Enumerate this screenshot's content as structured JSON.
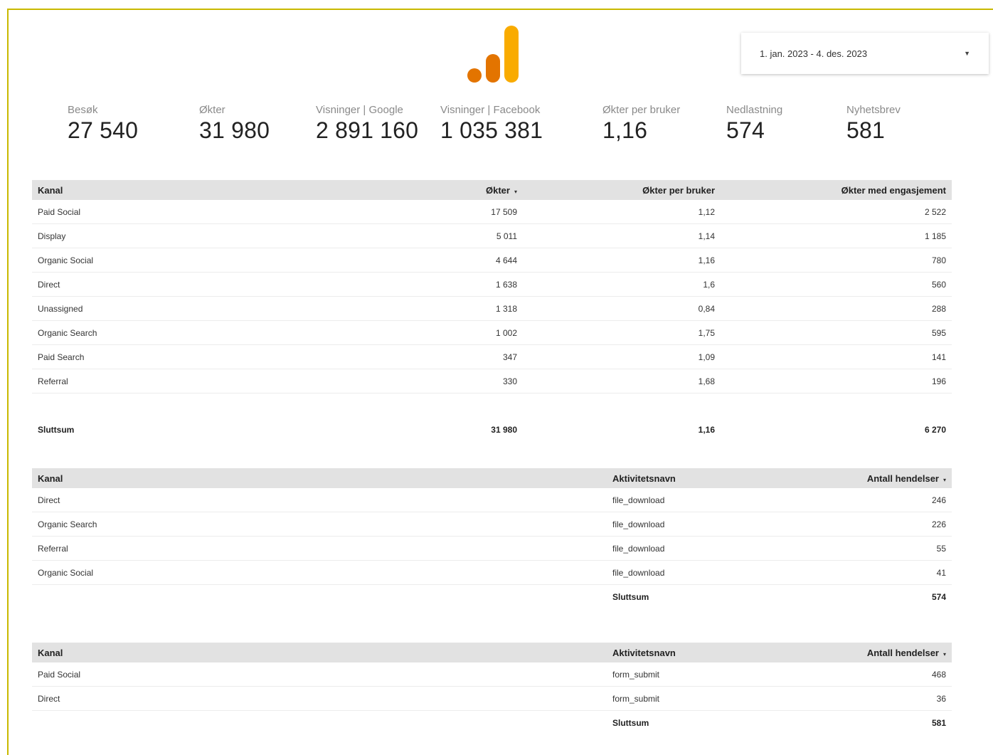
{
  "date_range": {
    "label": "1. jan. 2023 - 4. des. 2023"
  },
  "colors": {
    "frame": "#c8b800",
    "logo_light": "#f9ab00",
    "logo_dark": "#e37400",
    "header_bg": "#e2e2e2"
  },
  "kpis": [
    {
      "label": "Besøk",
      "value": "27 540"
    },
    {
      "label": "Økter",
      "value": "31 980"
    },
    {
      "label": "Visninger | Google",
      "value": "2 891 160"
    },
    {
      "label": "Visninger | Facebook",
      "value": "1 035 381"
    },
    {
      "label": "Økter per bruker",
      "value": "1,16"
    },
    {
      "label": "Nedlastning",
      "value": "574"
    },
    {
      "label": "Nyhetsbrev",
      "value": "581"
    }
  ],
  "table1": {
    "headers": [
      "Kanal",
      "Økter",
      "Økter per bruker",
      "Økter med engasjement"
    ],
    "sort_icon": "▾",
    "rows": [
      [
        "Paid Social",
        "17 509",
        "1,12",
        "2 522"
      ],
      [
        "Display",
        "5 011",
        "1,14",
        "1 185"
      ],
      [
        "Organic Social",
        "4 644",
        "1,16",
        "780"
      ],
      [
        "Direct",
        "1 638",
        "1,6",
        "560"
      ],
      [
        "Unassigned",
        "1 318",
        "0,84",
        "288"
      ],
      [
        "Organic Search",
        "1 002",
        "1,75",
        "595"
      ],
      [
        "Paid Search",
        "347",
        "1,09",
        "141"
      ],
      [
        "Referral",
        "330",
        "1,68",
        "196"
      ]
    ],
    "total": [
      "Sluttsum",
      "31 980",
      "1,16",
      "6 270"
    ]
  },
  "table2": {
    "headers": [
      "Kanal",
      "Aktivitetsnavn",
      "Antall hendelser"
    ],
    "sort_icon": "▾",
    "rows": [
      [
        "Direct",
        "file_download",
        "246"
      ],
      [
        "Organic Search",
        "file_download",
        "226"
      ],
      [
        "Referral",
        "file_download",
        "55"
      ],
      [
        "Organic Social",
        "file_download",
        "41"
      ]
    ],
    "total": [
      "Sluttsum",
      "574"
    ]
  },
  "table3": {
    "headers": [
      "Kanal",
      "Aktivitetsnavn",
      "Antall hendelser"
    ],
    "sort_icon": "▾",
    "rows": [
      [
        "Paid Social",
        "form_submit",
        "468"
      ],
      [
        "Direct",
        "form_submit",
        "36"
      ]
    ],
    "total": [
      "Sluttsum",
      "581"
    ]
  }
}
